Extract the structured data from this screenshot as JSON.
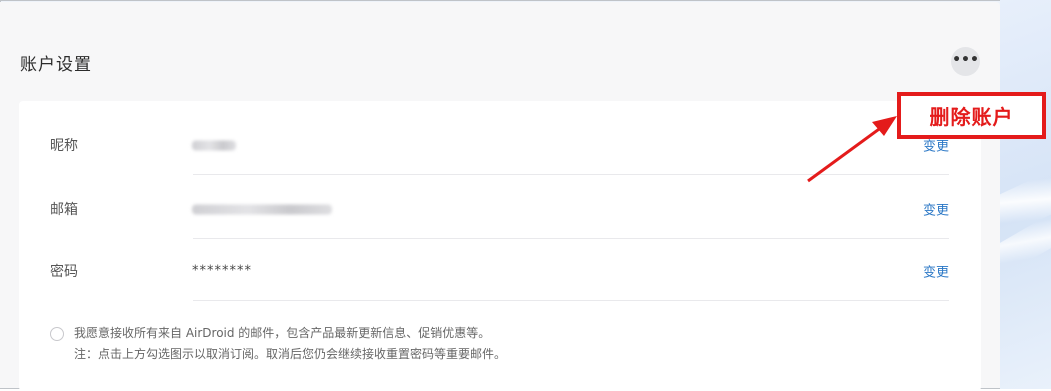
{
  "panel": {
    "title": "账户设置",
    "more_icon": "ellipsis-icon",
    "more_label": "•••"
  },
  "rows": [
    {
      "label": "昵称",
      "value": "",
      "value_redacted": true,
      "action": "变更"
    },
    {
      "label": "邮箱",
      "value": "",
      "value_redacted": true,
      "action": "变更"
    },
    {
      "label": "密码",
      "value": "********",
      "value_redacted": false,
      "action": "变更"
    }
  ],
  "consent": {
    "text": "我愿意接收所有来自 AirDroid 的邮件，包含产品最新更新信息、促销优惠等。",
    "note": "注：点击上方勾选图示以取消订阅。取消后您仍会继续接收重置密码等重要邮件。",
    "checked": false
  },
  "annotation": {
    "label": "删除账户",
    "color": "#e41b1b"
  },
  "colors": {
    "link": "#2a77c6",
    "panel_bg": "#f7f7f8",
    "card_bg": "#ffffff"
  }
}
